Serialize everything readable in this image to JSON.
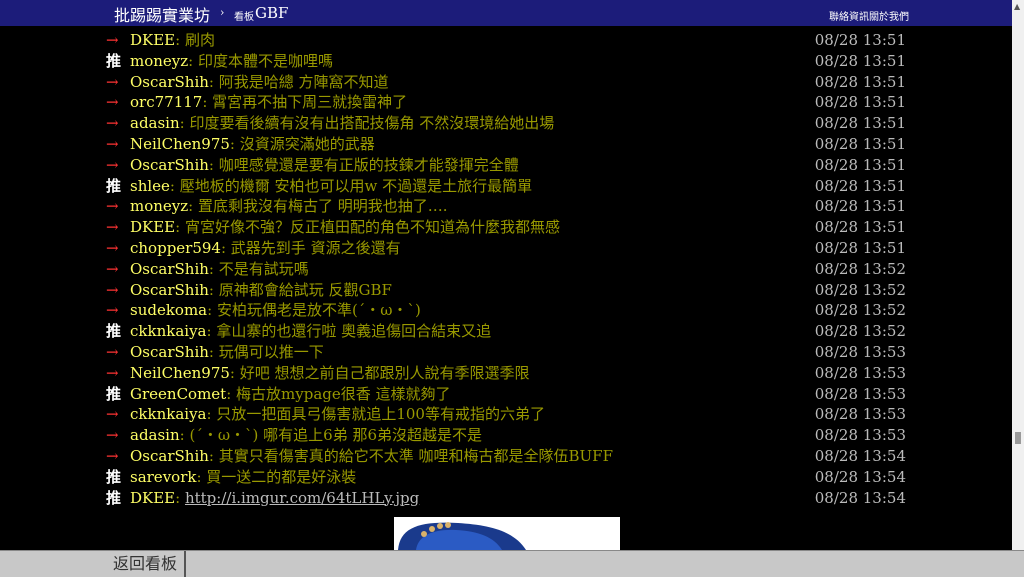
{
  "header": {
    "site_title": "批踢踢實業坊",
    "separator": "›",
    "board_label": "看板",
    "board_name": "GBF",
    "links": [
      "聯絡資訊",
      "關於我們"
    ]
  },
  "comments": [
    {
      "tag": "→",
      "user": "DKEE",
      "content": ": 刷肉",
      "time": "08/28 13:51"
    },
    {
      "tag": "推",
      "user": "moneyz",
      "content": ": 印度本體不是咖哩嗎",
      "time": "08/28 13:51"
    },
    {
      "tag": "→",
      "user": "OscarShih",
      "content": ": 阿我是哈總 方陣窩不知道",
      "time": "08/28 13:51"
    },
    {
      "tag": "→",
      "user": "orc77117",
      "content": ": 霄宮再不抽下周三就換雷神了",
      "time": "08/28 13:51"
    },
    {
      "tag": "→",
      "user": "adasin",
      "content": ": 印度要看後續有沒有出搭配技傷角 不然沒環境給她出場",
      "time": "08/28 13:51"
    },
    {
      "tag": "→",
      "user": "NeilChen975",
      "content": ": 沒資源突滿她的武器",
      "time": "08/28 13:51"
    },
    {
      "tag": "→",
      "user": "OscarShih",
      "content": ": 咖哩感覺還是要有正版的技鍊才能發揮完全體",
      "time": "08/28 13:51"
    },
    {
      "tag": "推",
      "user": "shlee",
      "content": ": 壓地板的機爾 安柏也可以用w 不過還是土旅行最簡單",
      "time": "08/28 13:51"
    },
    {
      "tag": "→",
      "user": "moneyz",
      "content": ": 置底剩我沒有梅古了 明明我也抽了….",
      "time": "08/28 13:51"
    },
    {
      "tag": "→",
      "user": "DKEE",
      "content": ": 宵宮好像不強？反正植田配的角色不知道為什麼我都無感",
      "time": "08/28 13:51"
    },
    {
      "tag": "→",
      "user": "chopper594",
      "content": ": 武器先到手  資源之後還有",
      "time": "08/28 13:51"
    },
    {
      "tag": "→",
      "user": "OscarShih",
      "content": ": 不是有試玩嗎",
      "time": "08/28 13:52"
    },
    {
      "tag": "→",
      "user": "OscarShih",
      "content": ": 原神都會給試玩 反觀GBF",
      "time": "08/28 13:52"
    },
    {
      "tag": "→",
      "user": "sudekoma",
      "content": ": 安柏玩偶老是放不準(´・ω・`)",
      "time": "08/28 13:52"
    },
    {
      "tag": "推",
      "user": "ckknkaiya",
      "content": ": 拿山寨的也還行啦 奧義追傷回合結束又追",
      "time": "08/28 13:52"
    },
    {
      "tag": "→",
      "user": "OscarShih",
      "content": ": 玩偶可以推一下",
      "time": "08/28 13:53"
    },
    {
      "tag": "→",
      "user": "NeilChen975",
      "content": ": 好吧 想想之前自己都跟別人說有季限選季限",
      "time": "08/28 13:53"
    },
    {
      "tag": "推",
      "user": "GreenComet",
      "content": ": 梅古放mypage很香 這樣就夠了",
      "time": "08/28 13:53"
    },
    {
      "tag": "→",
      "user": "ckknkaiya",
      "content": ": 只放一把面具弓傷害就追上100等有戒指的六弟了",
      "time": "08/28 13:53"
    },
    {
      "tag": "→",
      "user": "adasin",
      "content": ": (´・ω・`) 哪有追上6弟 那6弟沒超越是不是",
      "time": "08/28 13:53"
    },
    {
      "tag": "→",
      "user": "OscarShih",
      "content": ": 其實只看傷害真的給它不太準 咖哩和梅古都是全隊伍BUFF",
      "time": "08/28 13:54"
    },
    {
      "tag": "推",
      "user": "sarevork",
      "content": ": 買一送二的都是好泳裝",
      "time": "08/28 13:54"
    },
    {
      "tag": "推",
      "user": "DKEE",
      "content": ": ",
      "link": "http://i.imgur.com/64tLHLy.jpg",
      "time": "08/28 13:54"
    }
  ],
  "footer": {
    "back_button": "返回看板"
  }
}
